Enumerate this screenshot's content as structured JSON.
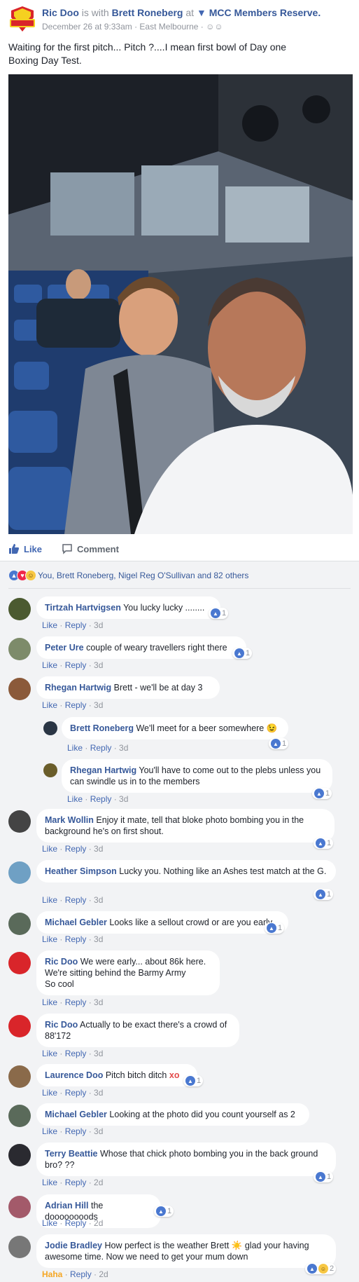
{
  "post": {
    "author": "Ric Doo",
    "with_text": "is with",
    "tagged": "Brett Roneberg",
    "at_text": "at",
    "place": "MCC Members Reserve.",
    "date": "December 26 at 9:33am",
    "location": "East Melbourne",
    "text": "Waiting for the first pitch... Pitch ?....I mean first bowl of Day one Boxing Day Test.",
    "actions": {
      "like": "Like",
      "comment": "Comment"
    }
  },
  "reactions": {
    "summary": "You, Brett Roneberg, Nigel Reg O'Sullivan and 82 others"
  },
  "comments": [
    {
      "author": "Tirtzah Hartvigsen",
      "text": "You lucky lucky ........",
      "count": "1",
      "like": "Like",
      "reply": "Reply",
      "time": "3d"
    },
    {
      "author": "Peter Ure",
      "text": "couple of weary travellers right there",
      "count": "1",
      "like": "Like",
      "reply": "Reply",
      "time": "3d"
    },
    {
      "author": "Rhegan Hartwig",
      "text": "Brett - we'll be at day 3",
      "like": "Like",
      "reply": "Reply",
      "time": "3d"
    },
    {
      "author": "Brett Roneberg",
      "text": "We'll meet for a beer somewhere 😉",
      "count": "1",
      "like": "Like",
      "reply": "Reply",
      "time": "3d"
    },
    {
      "author": "Rhegan Hartwig",
      "text": "You'll have to come out to the plebs unless you can swindle us in to the members",
      "count": "1",
      "like": "Like",
      "reply": "Reply",
      "time": "3d"
    },
    {
      "author": "Mark Wollin",
      "text": "Enjoy it mate, tell that bloke photo bombing you in the background he's on first shout.",
      "count": "1",
      "like": "Like",
      "reply": "Reply",
      "time": "3d"
    },
    {
      "author": "Heather Simpson",
      "text": "Lucky you. Nothing like an Ashes test match at the G.",
      "count": "1",
      "like": "Like",
      "reply": "Reply",
      "time": "3d"
    },
    {
      "author": "Michael Gebler",
      "text": "Looks like a sellout crowd or are you early.",
      "count": "1",
      "like": "Like",
      "reply": "Reply",
      "time": "3d"
    },
    {
      "author": "Ric Doo",
      "text": "We were early... about 86k here.\nWe're sitting behind the Barmy Army\nSo cool",
      "like": "Like",
      "reply": "Reply",
      "time": "3d"
    },
    {
      "author": "Ric Doo",
      "text": "Actually to be exact there's a crowd of 88'172",
      "like": "Like",
      "reply": "Reply",
      "time": "3d"
    },
    {
      "author": "Laurence Doo",
      "text": "Pitch bitch ditch",
      "emoji": "xo",
      "count": "1",
      "like": "Like",
      "reply": "Reply",
      "time": "3d"
    },
    {
      "author": "Michael Gebler",
      "text": "Looking at the photo did you count yourself as 2",
      "like": "Like",
      "reply": "Reply",
      "time": "3d"
    },
    {
      "author": "Terry Beattie",
      "text": "Whose that chick photo bombing you in the back ground bro? ??",
      "count": "1",
      "like": "Like",
      "reply": "Reply",
      "time": "2d"
    },
    {
      "author": "Adrian Hill",
      "text": "the doooooooods",
      "count": "1",
      "like": "Like",
      "reply": "Reply",
      "time": "2d"
    },
    {
      "author": "Jodie Bradley",
      "text": "How perfect is the weather Brett ☀️ glad your having awesome time. Now we need to get your mum down",
      "count": "2",
      "like": "Haha",
      "reply": "Reply",
      "time": "2d"
    }
  ]
}
